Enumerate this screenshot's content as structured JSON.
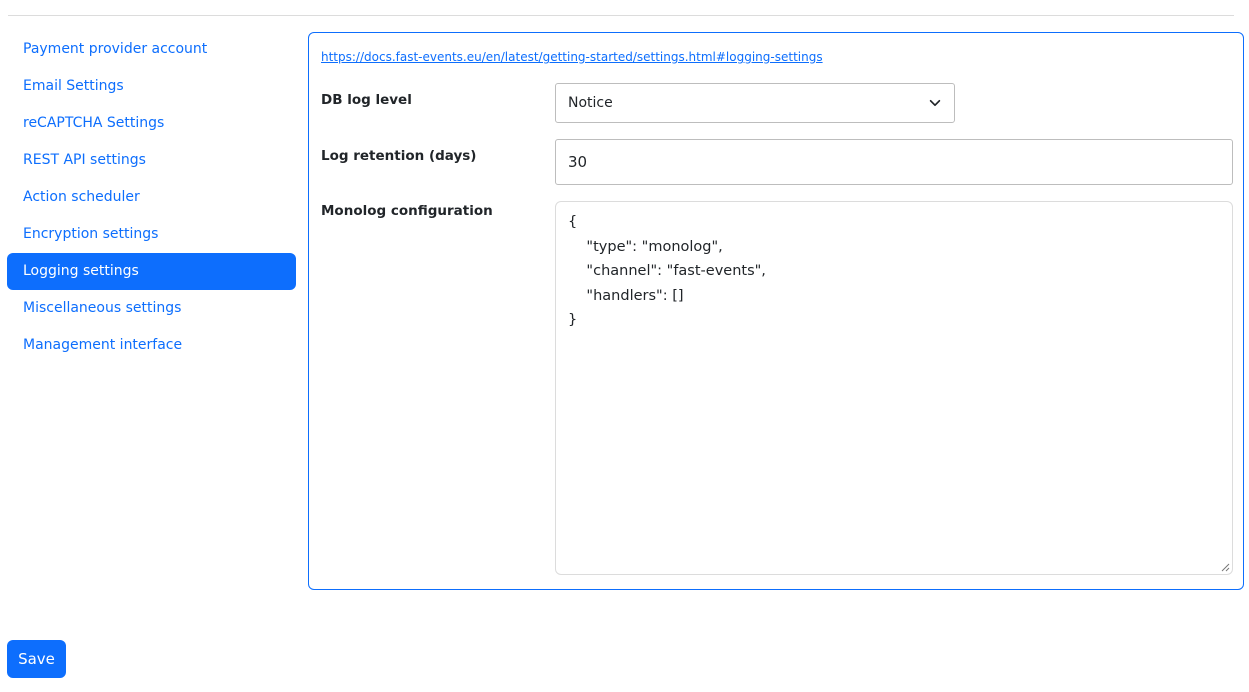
{
  "sidebar": {
    "items": [
      {
        "label": "Payment provider account"
      },
      {
        "label": "Email Settings"
      },
      {
        "label": "reCAPTCHA Settings"
      },
      {
        "label": "REST API settings"
      },
      {
        "label": "Action scheduler"
      },
      {
        "label": "Encryption settings"
      },
      {
        "label": "Logging settings",
        "active": true
      },
      {
        "label": "Miscellaneous settings"
      },
      {
        "label": "Management interface"
      }
    ]
  },
  "panel": {
    "doc_link": "https://docs.fast-events.eu/en/latest/getting-started/settings.html#logging-settings",
    "db_log_level": {
      "label": "DB log level",
      "value": "Notice"
    },
    "log_retention": {
      "label": "Log retention (days)",
      "value": "30"
    },
    "monolog": {
      "label": "Monolog configuration",
      "value": "{\n    \"type\": \"monolog\",\n    \"channel\": \"fast-events\",\n    \"handlers\": []\n}"
    }
  },
  "actions": {
    "save_label": "Save"
  },
  "icons": {
    "select_indicator": "chevron-down-icon",
    "textarea_resize": "resize-handle-icon"
  },
  "colors": {
    "accent": "#0d6efd",
    "active_item_text": "#ffffff",
    "body_text": "#212529"
  }
}
